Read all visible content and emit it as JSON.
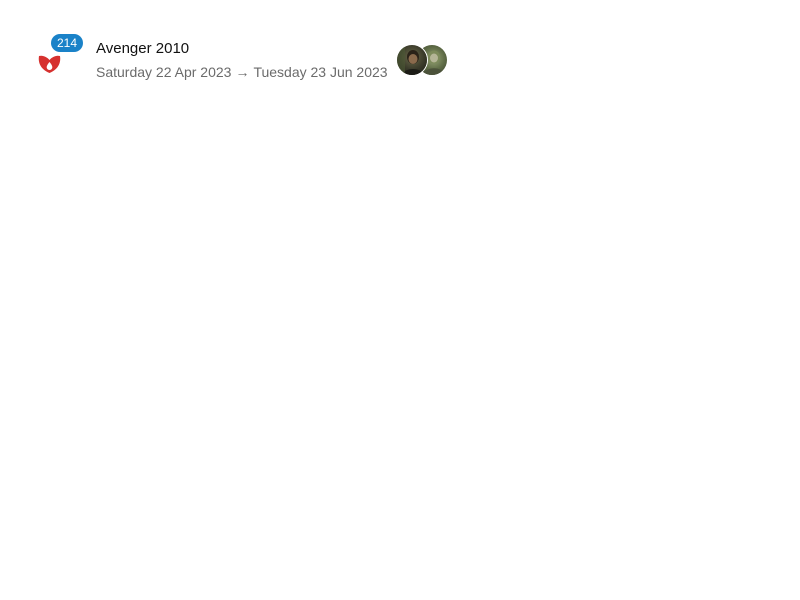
{
  "event": {
    "count_badge": "214",
    "title": "Avenger 2010",
    "start_date": "Saturday 22 Apr 2023",
    "arrow": "→",
    "end_date": "Tuesday 23 Jun 2023"
  },
  "colors": {
    "badge_bg": "#1a82c8",
    "icon_red": "#d6312f",
    "title_text": "#111111",
    "date_text": "#6b6b6b"
  },
  "icons": {
    "app_icon": "flame-app-icon",
    "avatars": [
      "user-avatar-dark",
      "user-avatar-green"
    ]
  }
}
